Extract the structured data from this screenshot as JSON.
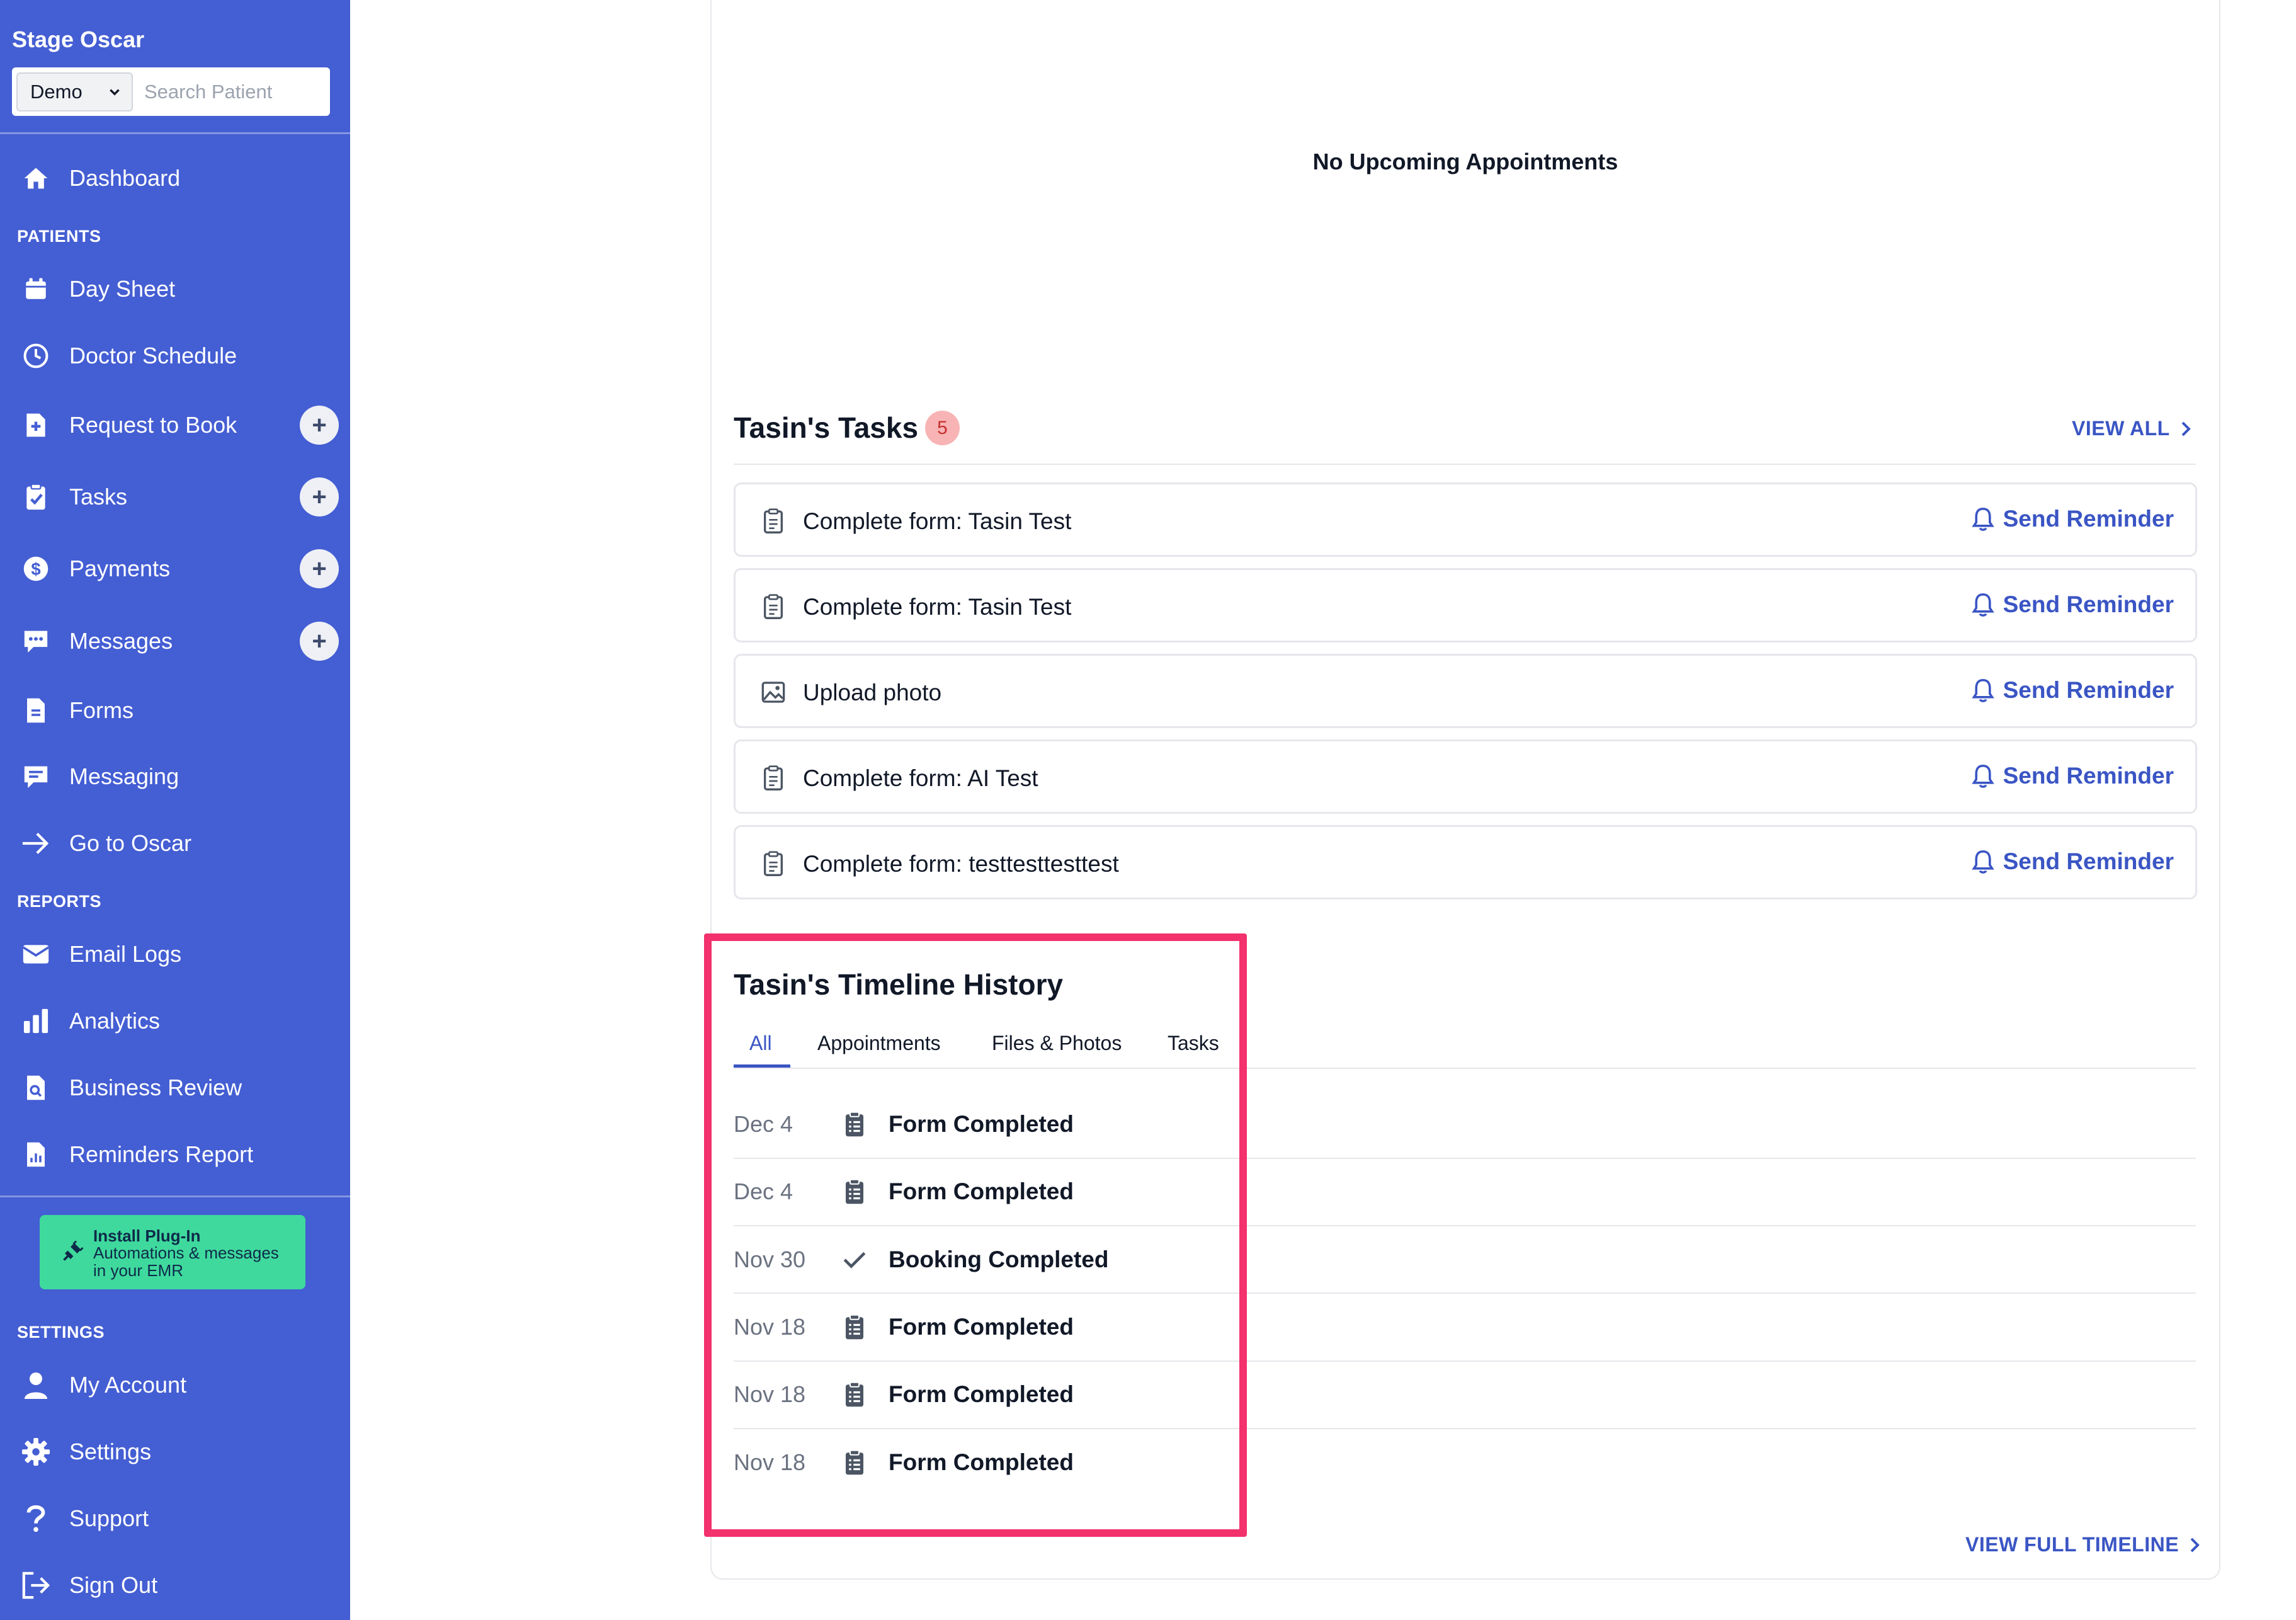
{
  "sidebar": {
    "brand": "Stage Oscar",
    "clinic_select": "Demo",
    "search_placeholder": "Search Patient",
    "dashboard": "Dashboard",
    "section_patients": "PATIENTS",
    "patients_items": [
      {
        "label": "Day Sheet",
        "icon": "calendar-icon"
      },
      {
        "label": "Doctor Schedule",
        "icon": "clock-icon"
      },
      {
        "label": "Request to Book",
        "icon": "document-plus-icon",
        "add": true
      },
      {
        "label": "Tasks",
        "icon": "clipboard-check-icon",
        "add": true
      },
      {
        "label": "Payments",
        "icon": "dollar-icon",
        "add": true
      },
      {
        "label": "Messages",
        "icon": "chat-icon",
        "add": true
      },
      {
        "label": "Forms",
        "icon": "document-icon"
      },
      {
        "label": "Messaging",
        "icon": "message-icon"
      },
      {
        "label": "Go to Oscar",
        "icon": "arrow-right-icon"
      }
    ],
    "section_reports": "REPORTS",
    "reports_items": [
      {
        "label": "Email Logs",
        "icon": "mail-icon"
      },
      {
        "label": "Analytics",
        "icon": "bar-chart-icon"
      },
      {
        "label": "Business Review",
        "icon": "document-search-icon"
      },
      {
        "label": "Reminders Report",
        "icon": "report-icon"
      }
    ],
    "plugin": {
      "title": "Install Plug-In",
      "subtitle": "Automations & messages in your EMR"
    },
    "section_settings": "SETTINGS",
    "settings_items": [
      {
        "label": "My Account",
        "icon": "user-icon"
      },
      {
        "label": "Settings",
        "icon": "gear-icon"
      },
      {
        "label": "Support",
        "icon": "question-icon"
      },
      {
        "label": "Sign Out",
        "icon": "sign-out-icon"
      }
    ]
  },
  "main": {
    "no_appointments": "No Upcoming Appointments",
    "tasks": {
      "title": "Tasin's Tasks",
      "count": "5",
      "view_all": "VIEW ALL",
      "reminder_label": "Send Reminder",
      "items": [
        {
          "label": "Complete form: Tasin Test",
          "icon": "clipboard-icon"
        },
        {
          "label": "Complete form: Tasin Test",
          "icon": "clipboard-icon"
        },
        {
          "label": "Upload photo",
          "icon": "image-icon"
        },
        {
          "label": "Complete form: AI Test",
          "icon": "clipboard-icon"
        },
        {
          "label": "Complete form: testtesttesttest",
          "icon": "clipboard-icon"
        }
      ]
    },
    "timeline": {
      "title": "Tasin's Timeline History",
      "tabs": [
        "All",
        "Appointments",
        "Files & Photos",
        "Tasks"
      ],
      "active_tab": "All",
      "rows": [
        {
          "date": "Dec 4",
          "event": "Form Completed",
          "icon": "clipboard-list-icon"
        },
        {
          "date": "Dec 4",
          "event": "Form Completed",
          "icon": "clipboard-list-icon"
        },
        {
          "date": "Nov 30",
          "event": "Booking Completed",
          "icon": "check-icon"
        },
        {
          "date": "Nov 18",
          "event": "Form Completed",
          "icon": "clipboard-list-icon"
        },
        {
          "date": "Nov 18",
          "event": "Form Completed",
          "icon": "clipboard-list-icon"
        },
        {
          "date": "Nov 18",
          "event": "Form Completed",
          "icon": "clipboard-list-icon"
        }
      ],
      "view_full": "VIEW FULL TIMELINE"
    }
  },
  "colors": {
    "sidebar": "#445ed3",
    "accent": "#3a55c4",
    "plugin": "#3fd99d",
    "highlight": "#f2316d",
    "badge_bg": "#f8b4b4"
  }
}
